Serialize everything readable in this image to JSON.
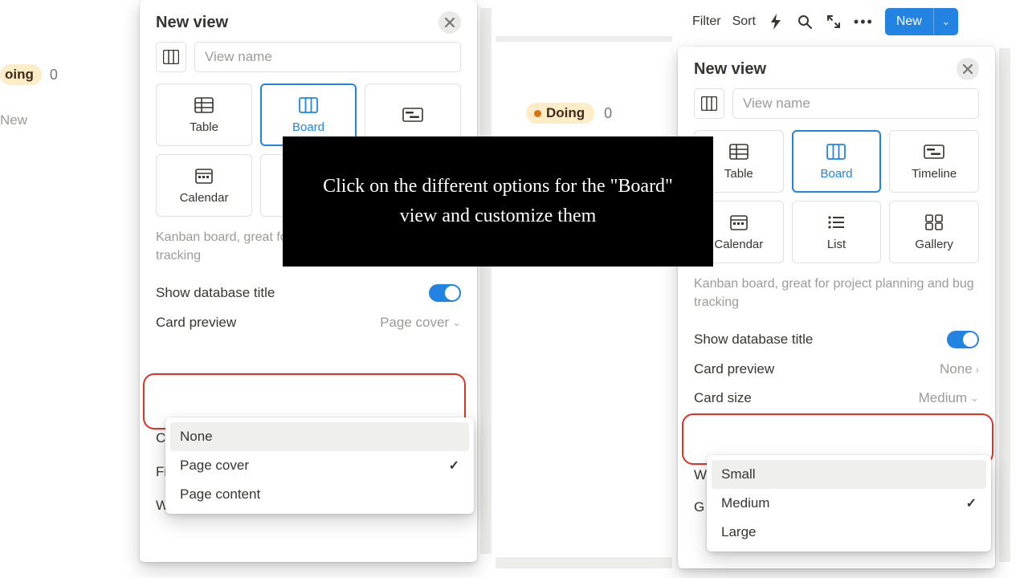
{
  "background_left": {
    "status_label": "oing",
    "status_count": "0",
    "new_label": "New"
  },
  "panel_left": {
    "title": "New view",
    "view_name_placeholder": "View name",
    "view_options": [
      {
        "label": "Table"
      },
      {
        "label": "Board",
        "selected": true
      },
      {
        "label": ""
      },
      {
        "label": "Calendar"
      },
      {
        "label": ""
      },
      {
        "label": ""
      }
    ],
    "description": "Kanban board, great for project planning and bug tracking",
    "settings": {
      "show_db_title_label": "Show database title",
      "show_db_title_on": true,
      "card_preview": {
        "label": "Card preview",
        "value": "Page cover"
      }
    },
    "truncated_rows": [
      "C",
      "Fi",
      "W"
    ],
    "dropdown": {
      "items": [
        {
          "label": "None",
          "hover": true
        },
        {
          "label": "Page cover",
          "checked": true
        },
        {
          "label": "Page content"
        }
      ]
    }
  },
  "topbar": {
    "filter": "Filter",
    "sort": "Sort",
    "new_button": "New"
  },
  "background_right": {
    "status_label": "Doing",
    "status_count": "0"
  },
  "panel_right": {
    "title": "New view",
    "view_name_placeholder": "View name",
    "view_options": [
      {
        "label": "Table"
      },
      {
        "label": "Board",
        "selected": true
      },
      {
        "label": "Timeline"
      },
      {
        "label": "Calendar"
      },
      {
        "label": "List"
      },
      {
        "label": "Gallery"
      }
    ],
    "description": "Kanban board, great for project planning and bug tracking",
    "settings": {
      "show_db_title_label": "Show database title",
      "show_db_title_on": true,
      "card_preview": {
        "label": "Card preview",
        "value": "None"
      },
      "card_size": {
        "label": "Card size",
        "value": "Medium"
      }
    },
    "truncated_rows": [
      "W",
      "G"
    ],
    "dropdown": {
      "items": [
        {
          "label": "Small",
          "hover": true
        },
        {
          "label": "Medium",
          "checked": true
        },
        {
          "label": "Large"
        }
      ]
    }
  },
  "callout": {
    "text": "Click on the different options for the \"Board\" view and customize them"
  },
  "icons": {
    "table": "table-icon",
    "board": "board-icon",
    "timeline": "timeline-icon",
    "calendar": "calendar-icon",
    "list": "list-icon",
    "gallery": "gallery-icon",
    "lightning": "lightning-icon",
    "search": "search-icon",
    "expand": "expand-icon"
  }
}
